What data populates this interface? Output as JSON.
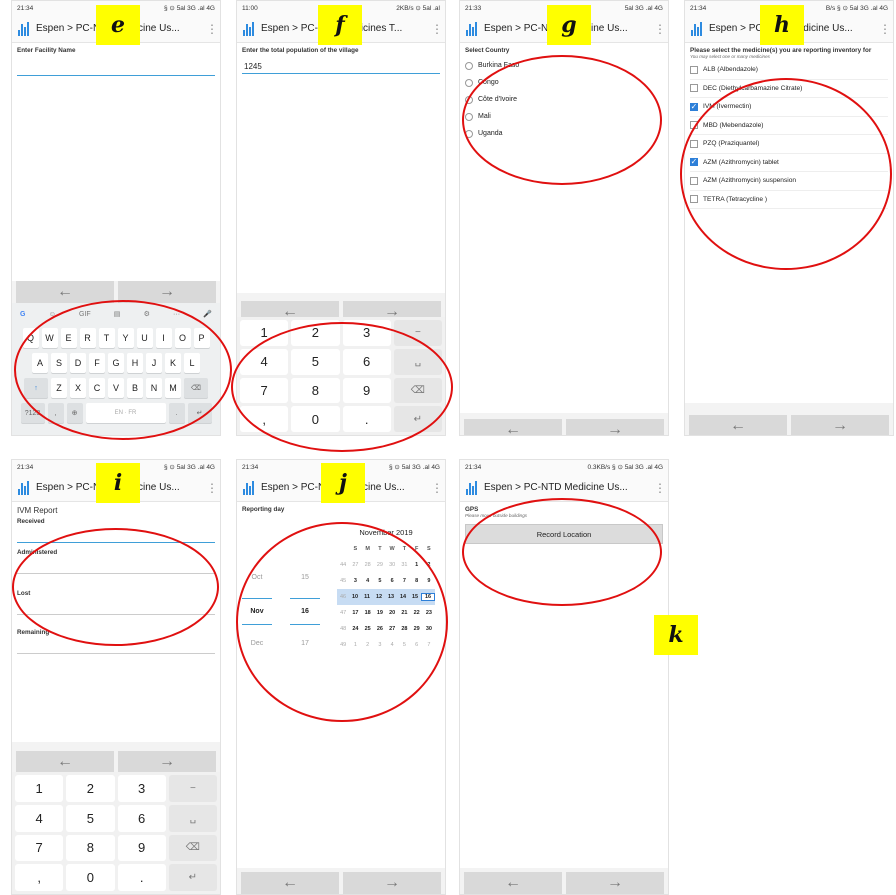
{
  "badges": {
    "e": "e",
    "f": "f",
    "g": "g",
    "h": "h",
    "i": "i",
    "j": "j",
    "k": "k"
  },
  "nav": {
    "back": "←",
    "forward": "→"
  },
  "menu_glyph": "⋮",
  "screen_e": {
    "time": "21:34",
    "status_right": "§ ⊙ 5al 3G .al 4G",
    "title": "Espen > PC-NTD Medicine Us...",
    "field_label": "Enter Facility Name",
    "suggestions": [
      "G",
      "☺",
      "GIF",
      "▤",
      "⚙",
      "···",
      "🎤"
    ],
    "row1": [
      "Q",
      "W",
      "E",
      "R",
      "T",
      "Y",
      "U",
      "I",
      "O",
      "P"
    ],
    "row2": [
      "A",
      "S",
      "D",
      "F",
      "G",
      "H",
      "J",
      "K",
      "L"
    ],
    "row3": [
      "↑",
      "Z",
      "X",
      "C",
      "V",
      "B",
      "N",
      "M",
      "⌫"
    ],
    "row4": [
      "?123",
      ",",
      "⊕",
      "EN · FR",
      ".",
      "↵"
    ]
  },
  "screen_f": {
    "time": "11:00",
    "status_right": "2KB/s ⊙ 5al .al",
    "title": "Espen > PC-NTD Medicines T...",
    "field_label": "Enter the total population of the village",
    "field_value": "1245",
    "keys": [
      "1",
      "2",
      "3",
      "−",
      "4",
      "5",
      "6",
      "␣",
      "7",
      "8",
      "9",
      "⌫",
      ",",
      "0",
      ".",
      "↵"
    ]
  },
  "screen_g": {
    "time": "21:33",
    "status_right": "5al 3G .al 4G",
    "title": "Espen > PC-NTD Medicine Us...",
    "field_label": "Select Country",
    "options": [
      "Burkina Faso",
      "Congo",
      "Côte d'Ivoire",
      "Mali",
      "Uganda"
    ]
  },
  "screen_h": {
    "time": "21:34",
    "status_right": "B/s § ⊙ 5al 3G .al 4G",
    "title": "Espen > PC-NTD Medicine Us...",
    "field_label": "Please select the medicine(s) you are reporting inventory for",
    "hint": "You may select one or many medicines",
    "options": [
      {
        "label": "ALB (Albendazole)",
        "checked": false
      },
      {
        "label": "DEC (Diethylcarbamazine Citrate)",
        "checked": false
      },
      {
        "label": "IVM (Ivermectin)",
        "checked": true
      },
      {
        "label": "MBD (Mebendazole)",
        "checked": false
      },
      {
        "label": "PZQ (Praziquantel)",
        "checked": false
      },
      {
        "label": "AZM (Azithromycin) tablet",
        "checked": true
      },
      {
        "label": "AZM (Azithromycin) suspension",
        "checked": false
      },
      {
        "label": "TETRA (Tetracycline )",
        "checked": false
      }
    ]
  },
  "screen_i": {
    "time": "21:34",
    "status_right": "§ ⊙ 5al 3G .al 4G",
    "title": "Espen > PC-NTD Medicine Us...",
    "report_title": "IVM Report",
    "fields": [
      "Received",
      "Administered",
      "Lost",
      "Remaining"
    ],
    "keys": [
      "1",
      "2",
      "3",
      "−",
      "4",
      "5",
      "6",
      "␣",
      "7",
      "8",
      "9",
      "⌫",
      ",",
      "0",
      ".",
      "↵"
    ]
  },
  "screen_j": {
    "time": "21:34",
    "status_right": "§ ⊙ 5al 3G .al 4G",
    "title": "Espen > PC-NTD Medicine Us...",
    "field_label": "Reporting day",
    "months": [
      "Oct",
      "Nov",
      "Dec"
    ],
    "days": [
      "15",
      "16",
      "17"
    ],
    "calendar_title": "November 2019",
    "weekdays": [
      "S",
      "M",
      "T",
      "W",
      "T",
      "F",
      "S"
    ],
    "weeks": [
      {
        "wk": "44",
        "days": [
          "27",
          "28",
          "29",
          "30",
          "31",
          "1",
          "2"
        ]
      },
      {
        "wk": "45",
        "days": [
          "3",
          "4",
          "5",
          "6",
          "7",
          "8",
          "9"
        ]
      },
      {
        "wk": "46",
        "days": [
          "10",
          "11",
          "12",
          "13",
          "14",
          "15",
          "16"
        ]
      },
      {
        "wk": "47",
        "days": [
          "17",
          "18",
          "19",
          "20",
          "21",
          "22",
          "23"
        ]
      },
      {
        "wk": "48",
        "days": [
          "24",
          "25",
          "26",
          "27",
          "28",
          "29",
          "30"
        ]
      },
      {
        "wk": "49",
        "days": [
          "1",
          "2",
          "3",
          "4",
          "5",
          "6",
          "7"
        ]
      }
    ]
  },
  "screen_k": {
    "time": "21:34",
    "status_right": "0.3KB/s § ⊙ 5al 3G .al 4G",
    "title": "Espen > PC-NTD Medicine Us...",
    "field_label": "GPS",
    "hint": "Please move outside buildings",
    "button_label": "Record Location"
  }
}
